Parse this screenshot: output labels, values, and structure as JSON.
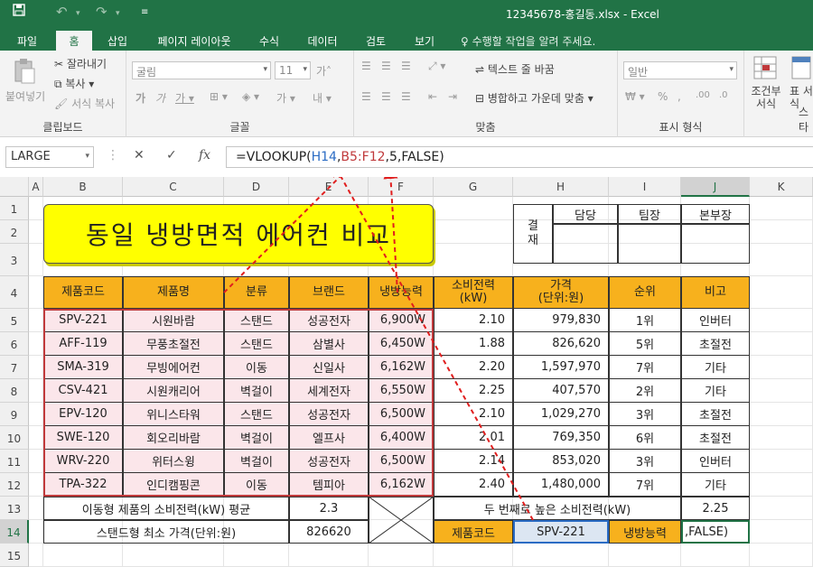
{
  "window": {
    "title": "12345678-홍길동.xlsx - Excel"
  },
  "tabs": [
    "파일",
    "홈",
    "삽입",
    "페이지 레이아웃",
    "수식",
    "데이터",
    "검토",
    "보기"
  ],
  "tell_me": "수행할 작업을 알려 주세요.",
  "ribbon": {
    "clipboard": {
      "paste": "붙여넣기",
      "cut": "잘라내기",
      "copy": "복사",
      "format_painter": "서식 복사",
      "label": "클립보드"
    },
    "font": {
      "name": "굴림",
      "size": "11",
      "label": "글꼴"
    },
    "alignment": {
      "wrap": "텍스트 줄 바꿈",
      "merge": "병합하고 가운데 맞춤",
      "label": "맞춤"
    },
    "number": {
      "format": "일반",
      "label": "표시 형식"
    },
    "styles": {
      "conditional": "조건부 서식",
      "table": "표 서식",
      "cell_styles": "스타"
    }
  },
  "formula_bar": {
    "name_box": "LARGE",
    "formula_prefix": "=VLOOKUP(",
    "ref1": "H14",
    "comma1": ",",
    "ref2": "B5:F12",
    "formula_suffix": ",5,FALSE)"
  },
  "columns": [
    "A",
    "B",
    "C",
    "D",
    "E",
    "F",
    "G",
    "H",
    "I",
    "J",
    "K"
  ],
  "rows": [
    "1",
    "2",
    "3",
    "4",
    "5",
    "6",
    "7",
    "8",
    "9",
    "10",
    "11",
    "12",
    "13",
    "14",
    "15"
  ],
  "sheet": {
    "title": "동일 냉방면적 에어컨 비교",
    "approval": {
      "label": "결\n재",
      "headers": [
        "담당",
        "팀장",
        "본부장"
      ]
    },
    "table_headers": [
      "제품코드",
      "제품명",
      "분류",
      "브랜드",
      "냉방능력",
      "소비전력\n(kW)",
      "가격\n(단위:원)",
      "순위",
      "비고"
    ],
    "table_rows": [
      [
        "SPV-221",
        "시원바람",
        "스탠드",
        "성공전자",
        "6,900W",
        "2.10",
        "979,830",
        "1위",
        "인버터"
      ],
      [
        "AFF-119",
        "무풍초절전",
        "스탠드",
        "삼별사",
        "6,450W",
        "1.88",
        "826,620",
        "5위",
        "초절전"
      ],
      [
        "SMA-319",
        "무빙에어컨",
        "이동",
        "신일사",
        "6,162W",
        "2.20",
        "1,597,970",
        "7위",
        "기타"
      ],
      [
        "CSV-421",
        "시원캐리어",
        "벽걸이",
        "세계전자",
        "6,550W",
        "2.25",
        "407,570",
        "2위",
        "기타"
      ],
      [
        "EPV-120",
        "위니스타워",
        "스탠드",
        "성공전자",
        "6,500W",
        "2.10",
        "1,029,270",
        "3위",
        "초절전"
      ],
      [
        "SWE-120",
        "회오리바람",
        "벽걸이",
        "엘프사",
        "6,400W",
        "2.01",
        "769,350",
        "6위",
        "초절전"
      ],
      [
        "WRV-220",
        "위터스윙",
        "벽걸이",
        "성공전자",
        "6,500W",
        "2.14",
        "853,020",
        "3위",
        "인버터"
      ],
      [
        "TPA-322",
        "인디캠핑콘",
        "이동",
        "템피아",
        "6,162W",
        "2.40",
        "1,480,000",
        "7위",
        "기타"
      ]
    ],
    "row13": {
      "label": "이동형 제품의 소비전력(kW) 평균",
      "value": "2.3",
      "label2": "두 번째로 높은 소비전력(kW)",
      "value2": "2.25"
    },
    "row14": {
      "label": "스탠드형 최소 가격(단위:원)",
      "value": "826620",
      "code_label": "제품코드",
      "code_value": "SPV-221",
      "cap_label": "냉방능력",
      "editing": ",FALSE)"
    }
  }
}
